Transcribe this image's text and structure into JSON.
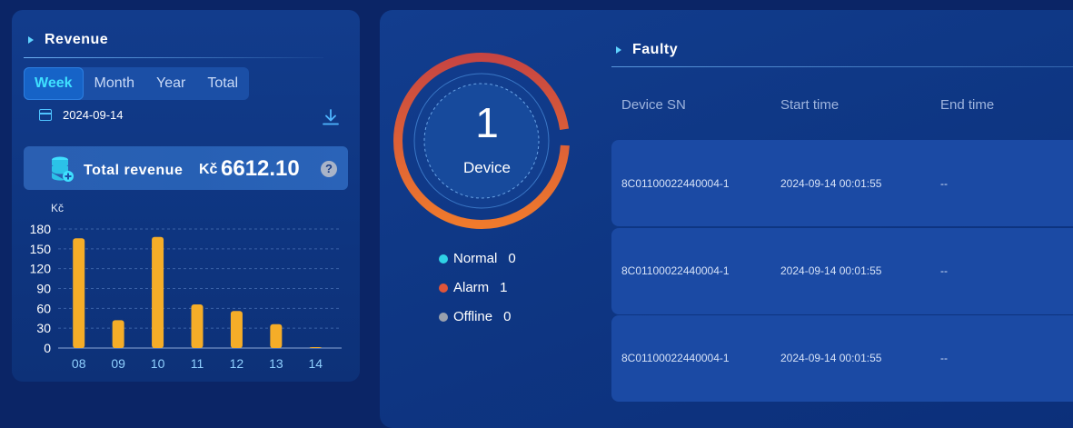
{
  "revenue": {
    "title": "Revenue",
    "tabs": [
      {
        "label": "Week",
        "active": true
      },
      {
        "label": "Month",
        "active": false
      },
      {
        "label": "Year",
        "active": false
      },
      {
        "label": "Total",
        "active": false
      }
    ],
    "date": "2024-09-14",
    "total_label": "Total revenue",
    "currency": "Kč",
    "total_value": "6612.10",
    "help": "?",
    "chart_unit": "Kč"
  },
  "chart_data": {
    "type": "bar",
    "categories": [
      "08",
      "09",
      "10",
      "11",
      "12",
      "13",
      "14"
    ],
    "values": [
      166,
      42,
      168,
      66,
      56,
      36,
      1
    ],
    "yticks": [
      0,
      30,
      60,
      90,
      120,
      150,
      180
    ],
    "ylim": [
      0,
      180
    ],
    "ylabel": "Kč",
    "grid": true,
    "bar_color": "#f5ad28"
  },
  "devices": {
    "count": "1",
    "label": "Device",
    "legend": [
      {
        "label": "Normal",
        "value": "0",
        "color": "#2fd2e6"
      },
      {
        "label": "Alarm",
        "value": "1",
        "color": "#e0553a"
      },
      {
        "label": "Offline",
        "value": "0",
        "color": "#9aa1ad"
      }
    ]
  },
  "faulty": {
    "title": "Faulty",
    "columns": [
      "Device SN",
      "Start time",
      "End time"
    ],
    "rows": [
      {
        "sn": "8C01100022440004-1",
        "start": "2024-09-14 00:01:55",
        "end": "--"
      },
      {
        "sn": "8C01100022440004-1",
        "start": "2024-09-14 00:01:55",
        "end": "--"
      },
      {
        "sn": "8C01100022440004-1",
        "start": "2024-09-14 00:01:55",
        "end": "--"
      }
    ]
  },
  "colors": {
    "accent": "#3fe0ff",
    "donut_start": "#d2453f",
    "donut_end": "#f07a2c"
  }
}
